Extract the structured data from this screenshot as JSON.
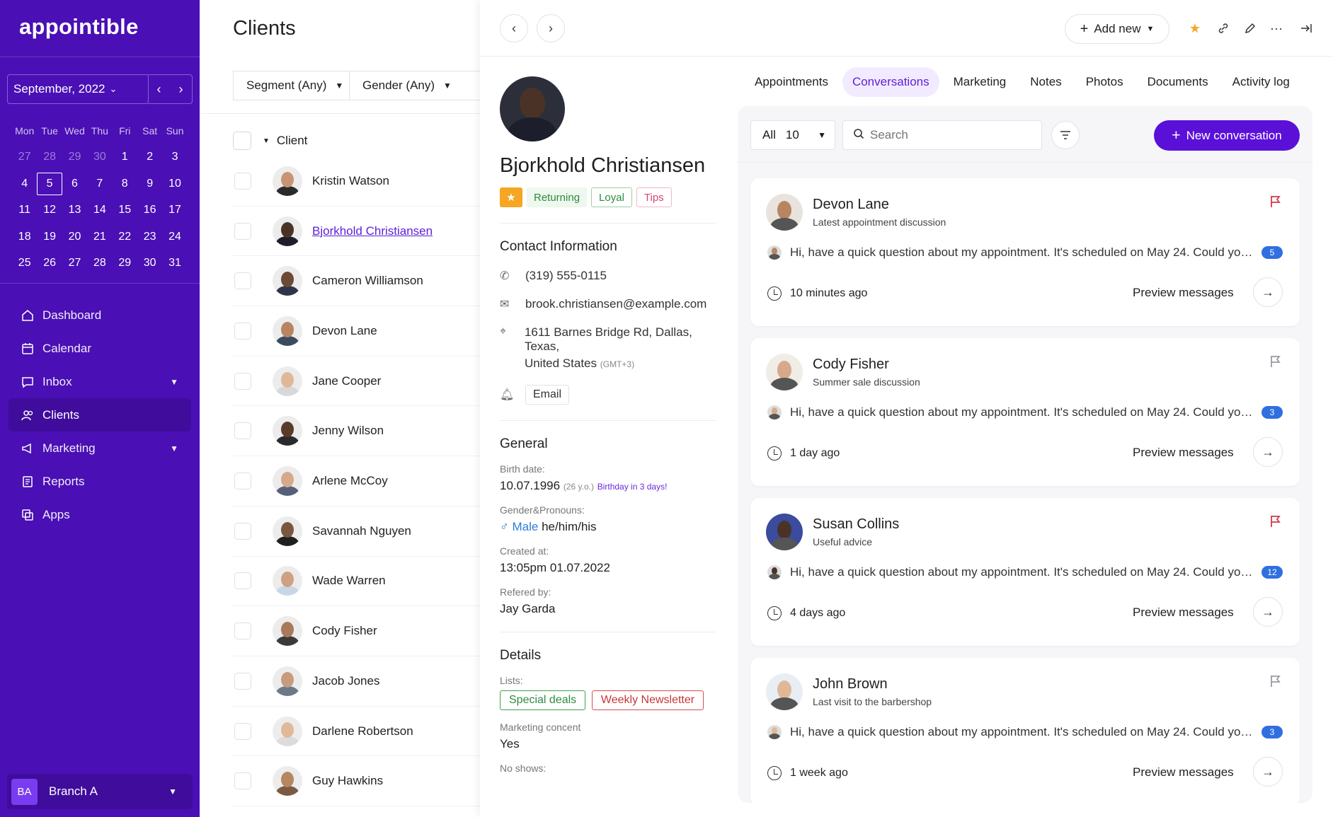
{
  "brand": {
    "logo": "appointible"
  },
  "calendar": {
    "month_label": "September, 2022",
    "weekdays": [
      "Mon",
      "Tue",
      "Wed",
      "Thu",
      "Fri",
      "Sat",
      "Sun"
    ],
    "weeks": [
      [
        "27",
        "28",
        "29",
        "30",
        "1",
        "2",
        "3"
      ],
      [
        "4",
        "5",
        "6",
        "7",
        "8",
        "9",
        "10"
      ],
      [
        "11",
        "12",
        "13",
        "14",
        "15",
        "16",
        "17"
      ],
      [
        "18",
        "19",
        "20",
        "21",
        "22",
        "23",
        "24"
      ],
      [
        "25",
        "26",
        "27",
        "28",
        "29",
        "30",
        "31"
      ]
    ],
    "selected_day": "5"
  },
  "nav": {
    "items": [
      {
        "label": "Dashboard",
        "icon": "home-icon"
      },
      {
        "label": "Calendar",
        "icon": "calendar-icon"
      },
      {
        "label": "Inbox",
        "icon": "inbox-icon"
      },
      {
        "label": "Clients",
        "icon": "users-icon"
      },
      {
        "label": "Marketing",
        "icon": "megaphone-icon"
      },
      {
        "label": "Reports",
        "icon": "report-icon"
      },
      {
        "label": "Apps",
        "icon": "apps-icon"
      }
    ],
    "active": "Clients"
  },
  "branch": {
    "initials": "BA",
    "label": "Branch A"
  },
  "clients": {
    "title": "Clients",
    "filters": {
      "segment": "Segment (Any)",
      "gender": "Gender (Any)"
    },
    "column": "Client",
    "rows": [
      "Kristin Watson",
      "Bjorkhold Christiansen",
      "Cameron Williamson",
      "Devon Lane",
      "Jane Cooper",
      "Jenny Wilson",
      "Arlene McCoy",
      "Savannah Nguyen",
      "Wade Warren",
      "Cody Fisher",
      "Jacob Jones",
      "Darlene Robertson",
      "Guy Hawkins"
    ]
  },
  "topbar": {
    "add_new": "Add new"
  },
  "profile": {
    "name": "Bjorkhold Christiansen",
    "tags": [
      "Returning",
      "Loyal",
      "Tips"
    ],
    "contact_title": "Contact Information",
    "phone": "(319) 555-0115",
    "email": "brook.christiansen@example.com",
    "address_line1": "1611 Barnes Bridge Rd, Dallas, Texas,",
    "address_line2": "United States",
    "timezone": "(GMT+3)",
    "reminder": "Email",
    "general_title": "General",
    "birth_label": "Birth date:",
    "birth_value": "10.07.1996",
    "age": "(26 y.o.)",
    "birthday_note": "Birthday in 3 days!",
    "gender_label": "Gender&Pronouns:",
    "gender": "Male",
    "pronouns": "he/him/his",
    "created_label": "Created at:",
    "created_value": "13:05pm 01.07.2022",
    "referred_label": "Refered by:",
    "referred_value": "Jay Garda",
    "details_title": "Details",
    "lists_label": "Lists:",
    "lists": [
      "Special deals",
      "Weekly Newsletter"
    ],
    "consent_label": "Marketing concent",
    "consent_value": "Yes",
    "noshows_label": "No shows:"
  },
  "tabs": [
    "Appointments",
    "Conversations",
    "Marketing",
    "Notes",
    "Photos",
    "Documents",
    "Activity log"
  ],
  "active_tab": "Conversations",
  "conversations": {
    "filter_label": "All",
    "filter_count": "10",
    "search_placeholder": "Search",
    "new_button": "New conversation",
    "preview_label": "Preview messages",
    "items": [
      {
        "name": "Devon Lane",
        "subject": "Latest appointment discussion",
        "message": "Hi, have a quick question about my appointment. It's scheduled on May 24. Could you please confirm",
        "count": "5",
        "time": "10 minutes ago",
        "flagged": true
      },
      {
        "name": "Cody Fisher",
        "subject": "Summer sale discussion",
        "message": "Hi, have a quick question about my appointment. It's scheduled on May 24. Could you please confirm",
        "count": "3",
        "time": "1 day ago",
        "flagged": false
      },
      {
        "name": "Susan Collins",
        "subject": "Useful advice",
        "message": "Hi, have a quick question about my appointment. It's scheduled on May 24. Could you please confirm",
        "count": "12",
        "time": "4 days ago",
        "flagged": true
      },
      {
        "name": "John Brown",
        "subject": "Last visit to the barbershop",
        "message": "Hi, have a quick question about my appointment. It's scheduled on May 24. Could you please confirm",
        "count": "3",
        "time": "1 week ago",
        "flagged": false
      }
    ]
  },
  "colors": {
    "brand": "#4a0fb5",
    "accent": "#5b10d8",
    "badge": "#2f6fe0",
    "flag_red": "#d23a4a"
  }
}
